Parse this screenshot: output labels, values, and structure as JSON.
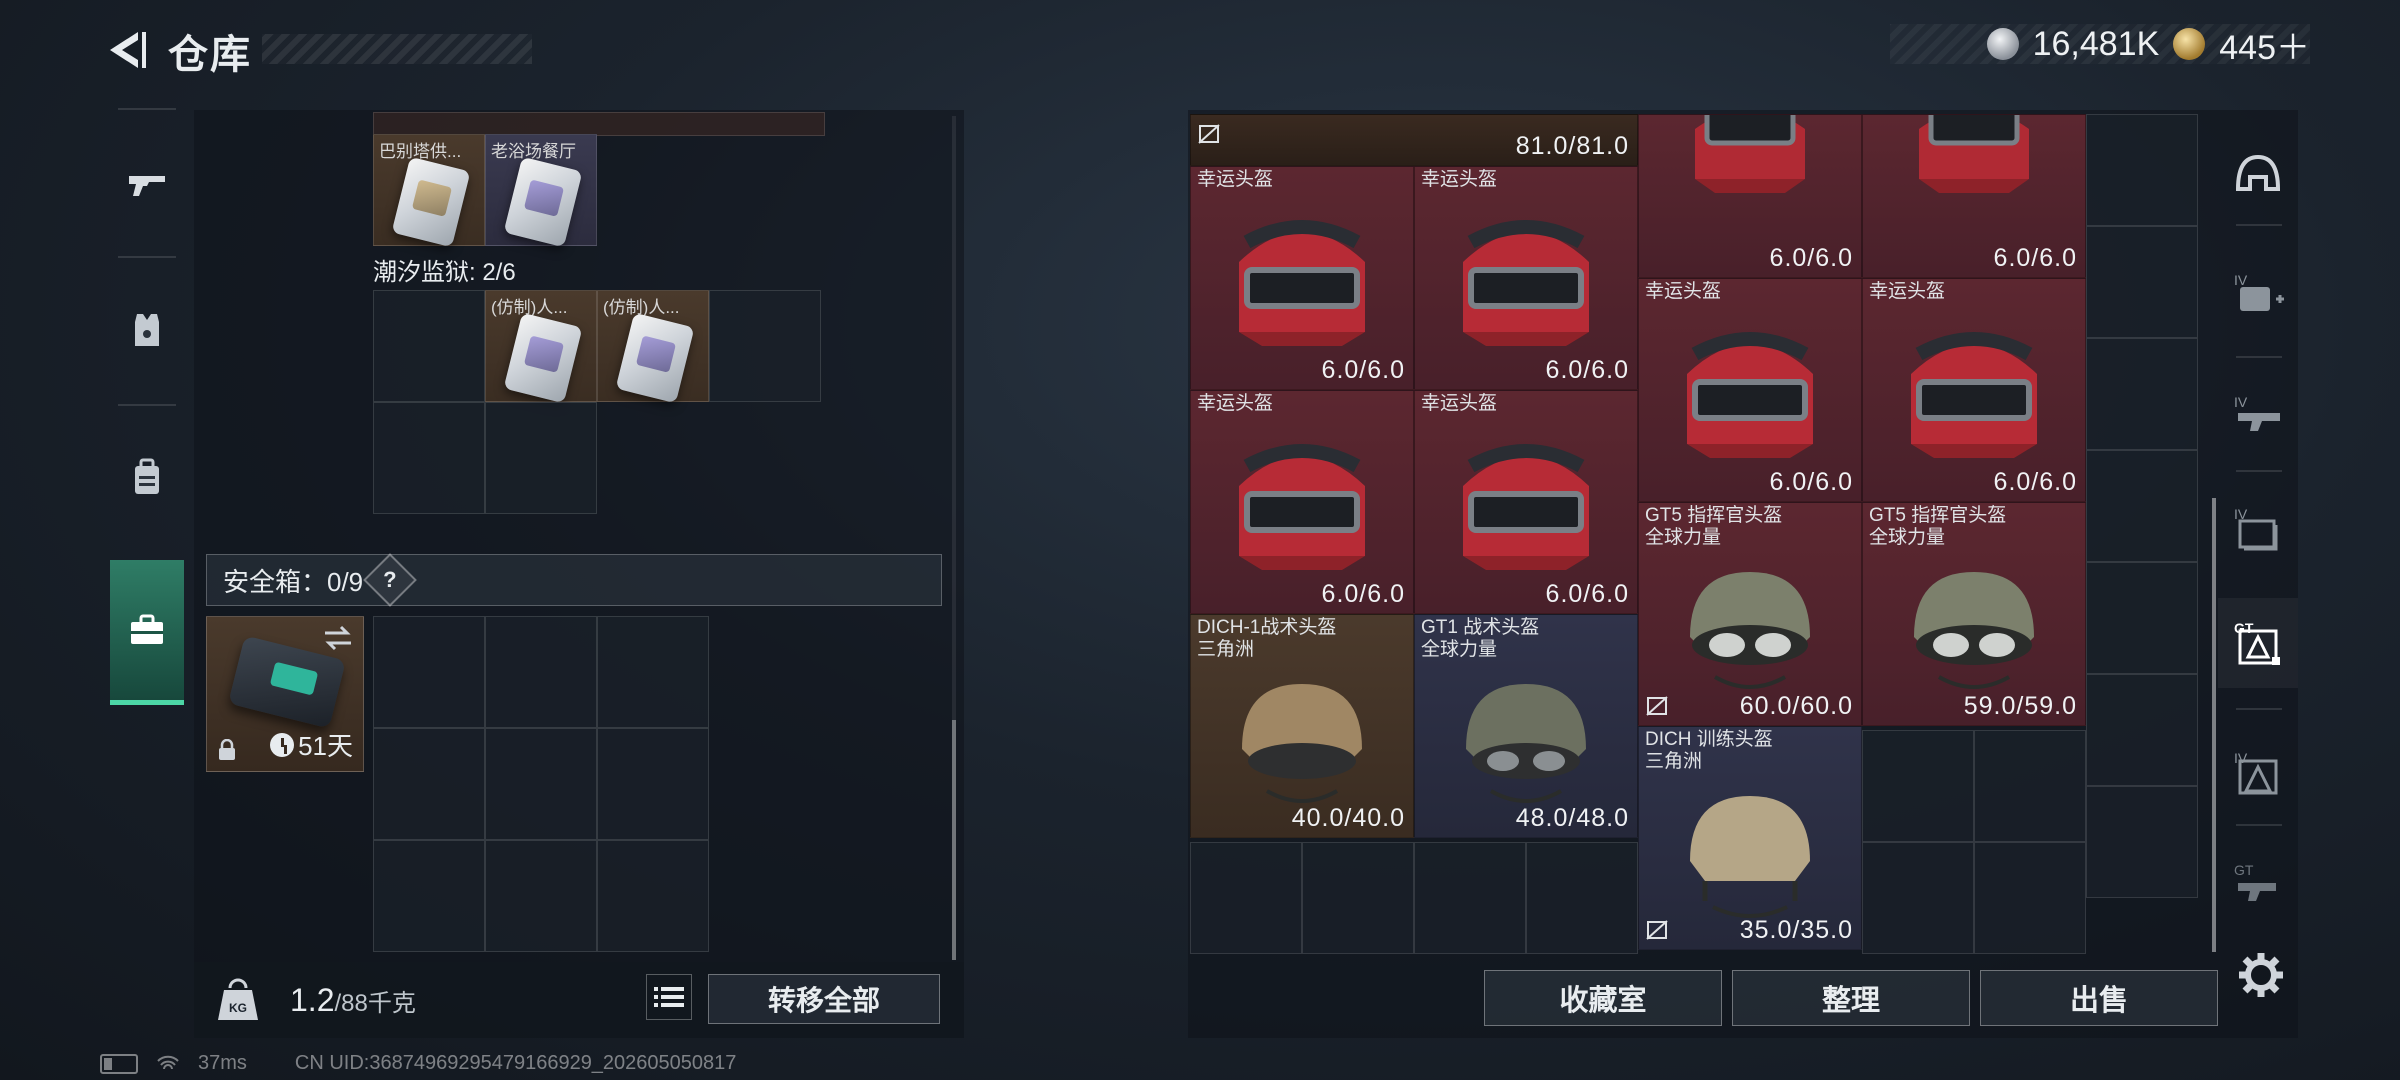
{
  "header": {
    "title": "仓库"
  },
  "currency": {
    "silver": "16,481K",
    "gold": "445＋"
  },
  "left_rail": {
    "tabs": [
      "gun-icon",
      "armor-vest-icon",
      "backpack-icon",
      "briefcase-icon"
    ]
  },
  "left_panel": {
    "top_items": [
      {
        "label": "巴别塔供...",
        "color": "orange"
      },
      {
        "label": "老浴场餐厅",
        "color": "purple"
      }
    ],
    "prison_section": {
      "label": "潮汐监狱: 2/6",
      "items": [
        {
          "label": "(仿制)人...",
          "color": "orange"
        },
        {
          "label": "(仿制)人...",
          "color": "orange"
        }
      ]
    },
    "safebox": {
      "label": "安全箱：0/9",
      "help": "?",
      "days": "51天"
    }
  },
  "weight": {
    "current": "1.2",
    "max": "/88千克"
  },
  "buttons": {
    "transfer_all": "转移全部",
    "collection": "收藏室",
    "organize": "整理",
    "sell": "出售"
  },
  "right_panel": {
    "items": [
      {
        "name": "",
        "durability": "81.0/81.0"
      },
      {
        "name": "",
        "durability": "6.0/6.0"
      },
      {
        "name": "",
        "durability": "6.0/6.0"
      },
      {
        "name": "幸运头盔",
        "durability": "6.0/6.0"
      },
      {
        "name": "幸运头盔",
        "durability": "6.0/6.0"
      },
      {
        "name": "幸运头盔",
        "durability": "6.0/6.0"
      },
      {
        "name": "幸运头盔",
        "durability": "6.0/6.0"
      },
      {
        "name": "幸运头盔",
        "durability": "6.0/6.0"
      },
      {
        "name": "幸运头盔",
        "durability": "6.0/6.0"
      },
      {
        "name": "GT5 指挥官头盔",
        "sub": "全球力量",
        "durability": "60.0/60.0"
      },
      {
        "name": "GT5 指挥官头盔",
        "sub": "全球力量",
        "durability": "59.0/59.0"
      },
      {
        "name": "DICH-1战术头盔",
        "sub": "三角洲",
        "durability": "40.0/40.0"
      },
      {
        "name": "GT1 战术头盔",
        "sub": "全球力量",
        "durability": "48.0/48.0"
      },
      {
        "name": "DICH 训练头盔",
        "sub": "三角洲",
        "durability": "35.0/35.0"
      }
    ]
  },
  "status_bar": {
    "ping": "37ms",
    "uid": "CN UID:36874969295479166929_202605050817"
  },
  "colors": {
    "accent_green": "#4cd6a6",
    "item_red": "#5c2730",
    "item_brown": "#4b3a2c",
    "item_navy": "#30334a"
  }
}
